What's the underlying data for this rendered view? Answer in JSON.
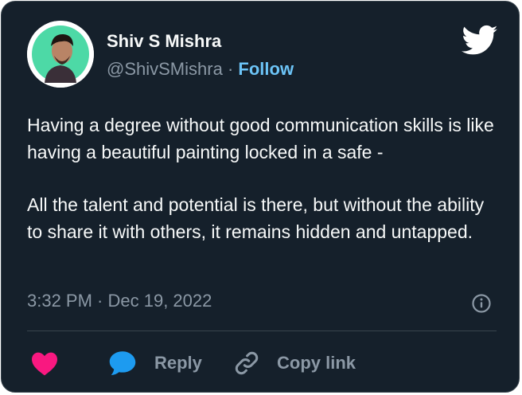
{
  "user": {
    "display_name": "Shiv S Mishra",
    "handle": "@ShivSMishra",
    "separator": "·",
    "follow_label": "Follow"
  },
  "tweet": {
    "paragraphs": [
      "Having a degree without good communication skills is like having a beautiful painting locked in a safe -",
      "All the talent and potential is there, but without the ability to share it with others, it remains hidden and untapped."
    ],
    "timestamp": "3:32 PM · Dec 19, 2022"
  },
  "actions": {
    "reply_label": "Reply",
    "copy_link_label": "Copy link"
  },
  "icons": {
    "brand": "twitter-bird-icon",
    "like": "heart-icon",
    "reply": "speech-bubble-icon",
    "copy": "link-icon",
    "info": "info-icon"
  },
  "colors": {
    "background": "#15202b",
    "border": "#38444d",
    "text": "#f7f9f9",
    "muted": "#8b98a5",
    "follow": "#6cc4f7",
    "heart": "#f91880",
    "reply_bubble": "#1d9bf0"
  }
}
